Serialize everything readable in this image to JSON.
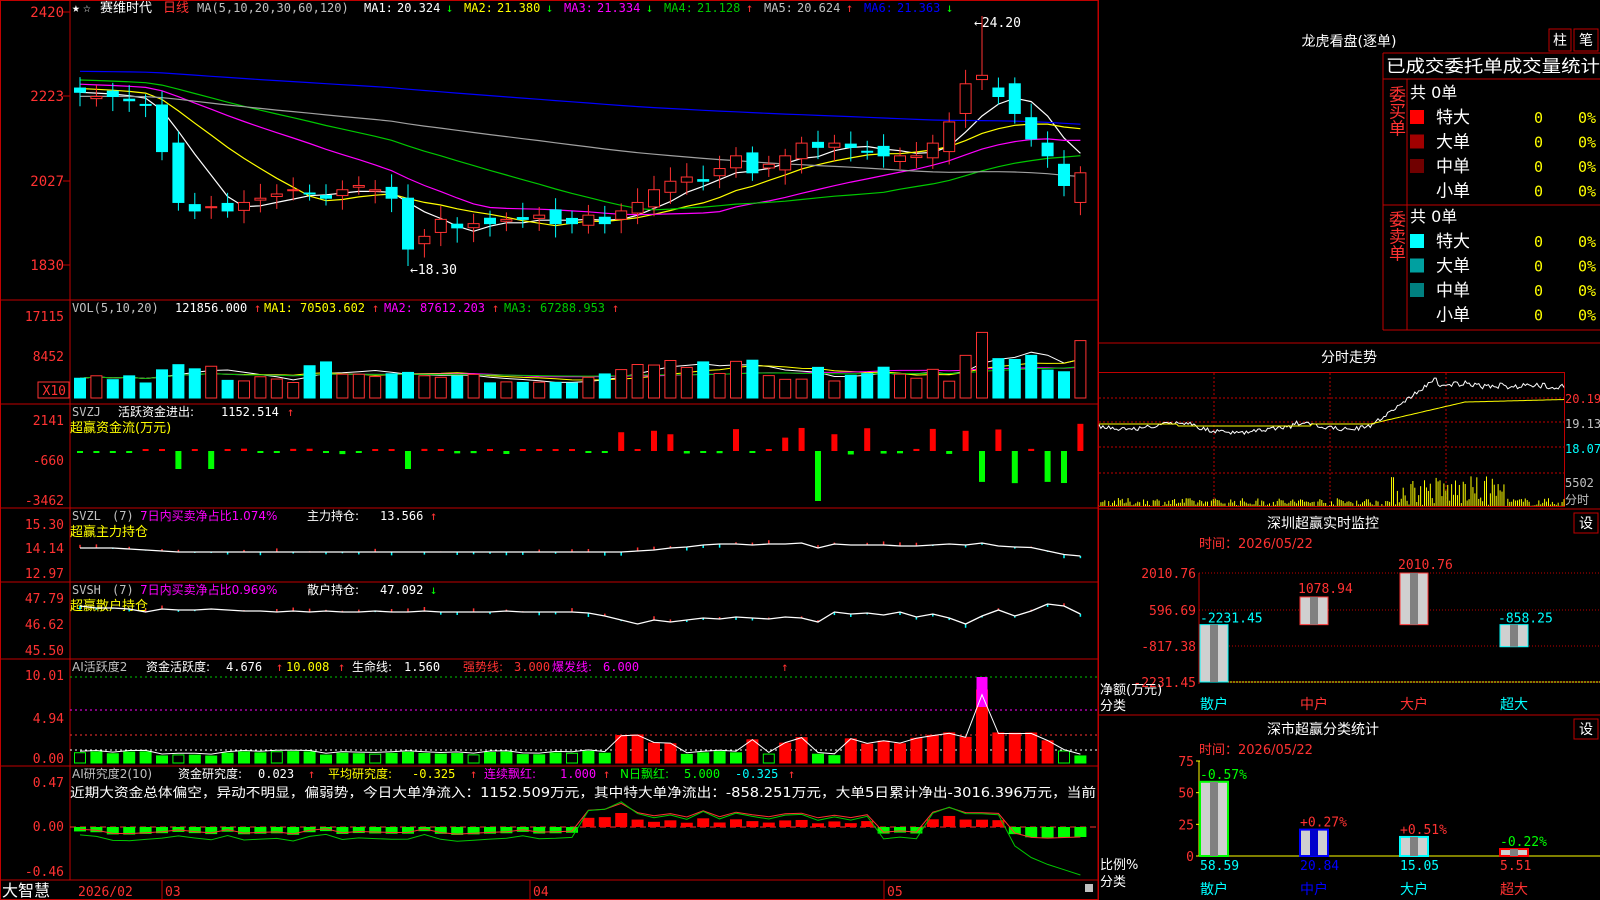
{
  "app": {
    "name": "大智慧"
  },
  "stock": {
    "name": "赛维时代",
    "period": "日线"
  },
  "colors": {
    "up": "#ff3232",
    "down": "#00ffff",
    "bg": "#000000",
    "frame": "#c00000",
    "white": "#ffffff",
    "yellow": "#ffff00",
    "magenta": "#ff00ff",
    "green": "#00c800",
    "blue": "#0000ff",
    "gray": "#a0a0a0"
  },
  "price_panel": {
    "indicator_label": "MA(5,10,20,30,60,120)",
    "ma": [
      {
        "label": "MA1:",
        "value": "20.324",
        "arrow": "↓",
        "color": "#ffffff"
      },
      {
        "label": "MA2:",
        "value": "21.380",
        "arrow": "↓",
        "color": "#ffff00"
      },
      {
        "label": "MA3:",
        "value": "21.334",
        "arrow": "↓",
        "color": "#ff00ff"
      },
      {
        "label": "MA4:",
        "value": "21.128",
        "arrow": "↑",
        "color": "#00c800"
      },
      {
        "label": "MA5:",
        "value": "20.624",
        "arrow": "↑",
        "color": "#c0c0c0"
      },
      {
        "label": "MA6:",
        "value": "21.363",
        "arrow": "↓",
        "color": "#0000ff"
      }
    ],
    "y_ticks": [
      "2420",
      "2223",
      "2027",
      "1830"
    ],
    "high_label": "24.20",
    "low_label": "18.30"
  },
  "volume_panel": {
    "label": "VOL(5,10,20)",
    "value": "121856.000",
    "value_arrow": "↑",
    "ma1": "70503.602",
    "ma1_arrow": "↑",
    "ma2": "87612.203",
    "ma2_arrow": "↑",
    "ma3": "67288.953",
    "ma3_arrow": "↑",
    "y_ticks": [
      "17115",
      "8452"
    ],
    "unit": "X10"
  },
  "fund_panel": {
    "label": "SVZJ",
    "name": "活跃资金进出:",
    "value": "1152.514",
    "arrow": "↑",
    "sub": "超赢资金流(万元)",
    "y_ticks": [
      "2141",
      "-660",
      "-3462"
    ]
  },
  "main_hold_panel": {
    "label": "SVZL",
    "period": "(7)",
    "desc": "7日内买卖净占比1.074%",
    "name": "主力持仓:",
    "value": "13.566",
    "arrow": "↑",
    "sub": "超赢主力持仓",
    "y_ticks": [
      "15.30",
      "14.14",
      "12.97"
    ]
  },
  "retail_panel": {
    "label": "SVSH",
    "period": "(7)",
    "desc": "7日内买卖净占比0.969%",
    "name": "散户持仓:",
    "value": "47.092",
    "arrow": "↓",
    "sub": "超赢散户持仓",
    "y_ticks": [
      "47.79",
      "46.62",
      "45.50"
    ]
  },
  "activity_panel": {
    "label": "AI活跃度2",
    "name": "资金活跃度:",
    "value": "4.676",
    "arrow": "↑",
    "v2": "10.008",
    "life_label": "生命线:",
    "life": "1.560",
    "strong_label": "强势线:",
    "strong": "3.000",
    "burst_label": "爆发线:",
    "burst": "6.000",
    "y_ticks": [
      "10.01",
      "4.94",
      "0.00"
    ]
  },
  "research_panel": {
    "label": "AI研究度2(10)",
    "name": "资金研究度:",
    "value": "0.023",
    "arrow": "↑",
    "avg_label": "平均研究度:",
    "avg": "-0.325",
    "avg_arrow": "↑",
    "streak_label": "连续飘红:",
    "streak": "1.000",
    "streak_arrow": "↑",
    "n_label": "N日飘红:",
    "n": "5.000",
    "n2": "-0.325",
    "n2_arrow": "↑",
    "comment": "近期大资金总体偏空，异动不明显，偏弱势，今日大单净流入：1152.509万元，其中特大单净流出：-858.251万元，大单5日累计净出-3016.396万元，当前",
    "y_ticks": [
      "0.47",
      "0.00",
      "-0.46"
    ]
  },
  "x_axis": {
    "labels": [
      "2026/02",
      "03",
      "04",
      "05"
    ]
  },
  "dragon_tiger": {
    "title": "龙虎看盘(逐单)",
    "btn1": "柱",
    "btn2": "笔",
    "header": "已成交委托单成交量统计",
    "buy_label": "委买单",
    "sell_label": "委卖单",
    "buy_total": "共 0单",
    "sell_total": "共 0单",
    "buy_rows": [
      {
        "name": "特大",
        "value": "0",
        "pct": "0%",
        "color": "#ff0000"
      },
      {
        "name": "大单",
        "value": "0",
        "pct": "0%",
        "color": "#a00000"
      },
      {
        "name": "中单",
        "value": "0",
        "pct": "0%",
        "color": "#700000"
      },
      {
        "name": "小单",
        "value": "0",
        "pct": "0%",
        "color": ""
      }
    ],
    "sell_rows": [
      {
        "name": "特大",
        "value": "0",
        "pct": "0%",
        "color": "#00ffff"
      },
      {
        "name": "大单",
        "value": "0",
        "pct": "0%",
        "color": "#00a0a0"
      },
      {
        "name": "中单",
        "value": "0",
        "pct": "0%",
        "color": "#008080"
      },
      {
        "name": "小单",
        "value": "0",
        "pct": "0%",
        "color": ""
      }
    ]
  },
  "intraday": {
    "title": "分时走势",
    "y_ticks": [
      "20.19",
      "19.13",
      "18.07"
    ],
    "vol_tick": "5502",
    "vol_label": "分时"
  },
  "sz_monitor": {
    "title": "深圳超赢实时监控",
    "btn": "设",
    "date": "时间：2026/05/22",
    "ylabel": "净额(万元)",
    "xlabel": "分类",
    "y_ticks": [
      "2010.76",
      "596.69",
      "-817.38",
      "-2231.45"
    ],
    "chart_data": {
      "type": "bar",
      "categories": [
        "散户",
        "中户",
        "大户",
        "超大"
      ],
      "values": [
        -2231.45,
        1078.94,
        2010.76,
        -858.25
      ],
      "value_labels": [
        "-2231.45",
        "1078.94",
        "2010.76",
        "-858.25"
      ],
      "ylabel": "净额(万元)",
      "xlabel": "分类",
      "ylim": [
        -2231.45,
        2010.76
      ]
    }
  },
  "sz_class": {
    "title": "深市超赢分类统计",
    "btn": "设",
    "date": "时间：2026/05/22",
    "ylabel": "比例%",
    "xlabel": "分类",
    "y_ticks": [
      "75",
      "50",
      "25",
      "0"
    ],
    "chart_data": {
      "type": "bar",
      "categories": [
        "散户",
        "中户",
        "大户",
        "超大"
      ],
      "values": [
        58.59,
        20.84,
        15.05,
        5.51
      ],
      "value_labels": [
        "58.59",
        "20.84",
        "15.05",
        "5.51"
      ],
      "changes": [
        "-0.57%",
        "+0.27%",
        "+0.51%",
        "-0.22%"
      ],
      "ylabel": "比例%",
      "xlabel": "分类",
      "ylim": [
        0,
        75
      ]
    }
  }
}
